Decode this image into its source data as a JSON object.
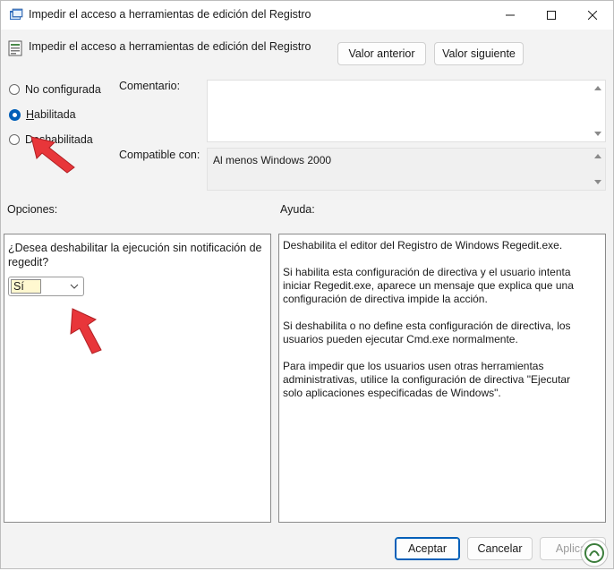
{
  "window": {
    "title": "Impedir el acceso a herramientas de edición del Registro"
  },
  "header": {
    "policy_title": "Impedir el acceso a herramientas de edición del Registro",
    "prev_button": "Valor anterior",
    "next_button": "Valor siguiente"
  },
  "state": {
    "options": [
      {
        "label": "No configurada",
        "checked": false
      },
      {
        "label": "Habilitada",
        "checked": true
      },
      {
        "label": "Deshabilitada",
        "checked": false
      }
    ]
  },
  "comment": {
    "label": "Comentario:",
    "value": ""
  },
  "supported": {
    "label": "Compatible con:",
    "value": "Al menos Windows 2000"
  },
  "options_section": {
    "label": "Opciones:",
    "question": "¿Desea deshabilitar la ejecución sin notificación de regedit?",
    "combo_value": "Sí"
  },
  "help_section": {
    "label": "Ayuda:",
    "paragraphs": [
      "Deshabilita el editor del Registro de Windows Regedit.exe.",
      "Si habilita esta configuración de directiva y el usuario intenta iniciar Regedit.exe, aparece un mensaje que explica que una configuración de directiva impide la acción.",
      "Si deshabilita o no define esta configuración de directiva, los usuarios pueden ejecutar Cmd.exe normalmente.",
      "Para impedir que los usuarios usen otras herramientas administrativas, utilice la configuración de directiva \"Ejecutar solo aplicaciones especificadas de Windows\"."
    ]
  },
  "footer": {
    "ok": "Aceptar",
    "cancel": "Cancelar",
    "apply": "Aplicar"
  },
  "colors": {
    "accent": "#005fb8",
    "annotation_arrow": "#e8363a"
  }
}
